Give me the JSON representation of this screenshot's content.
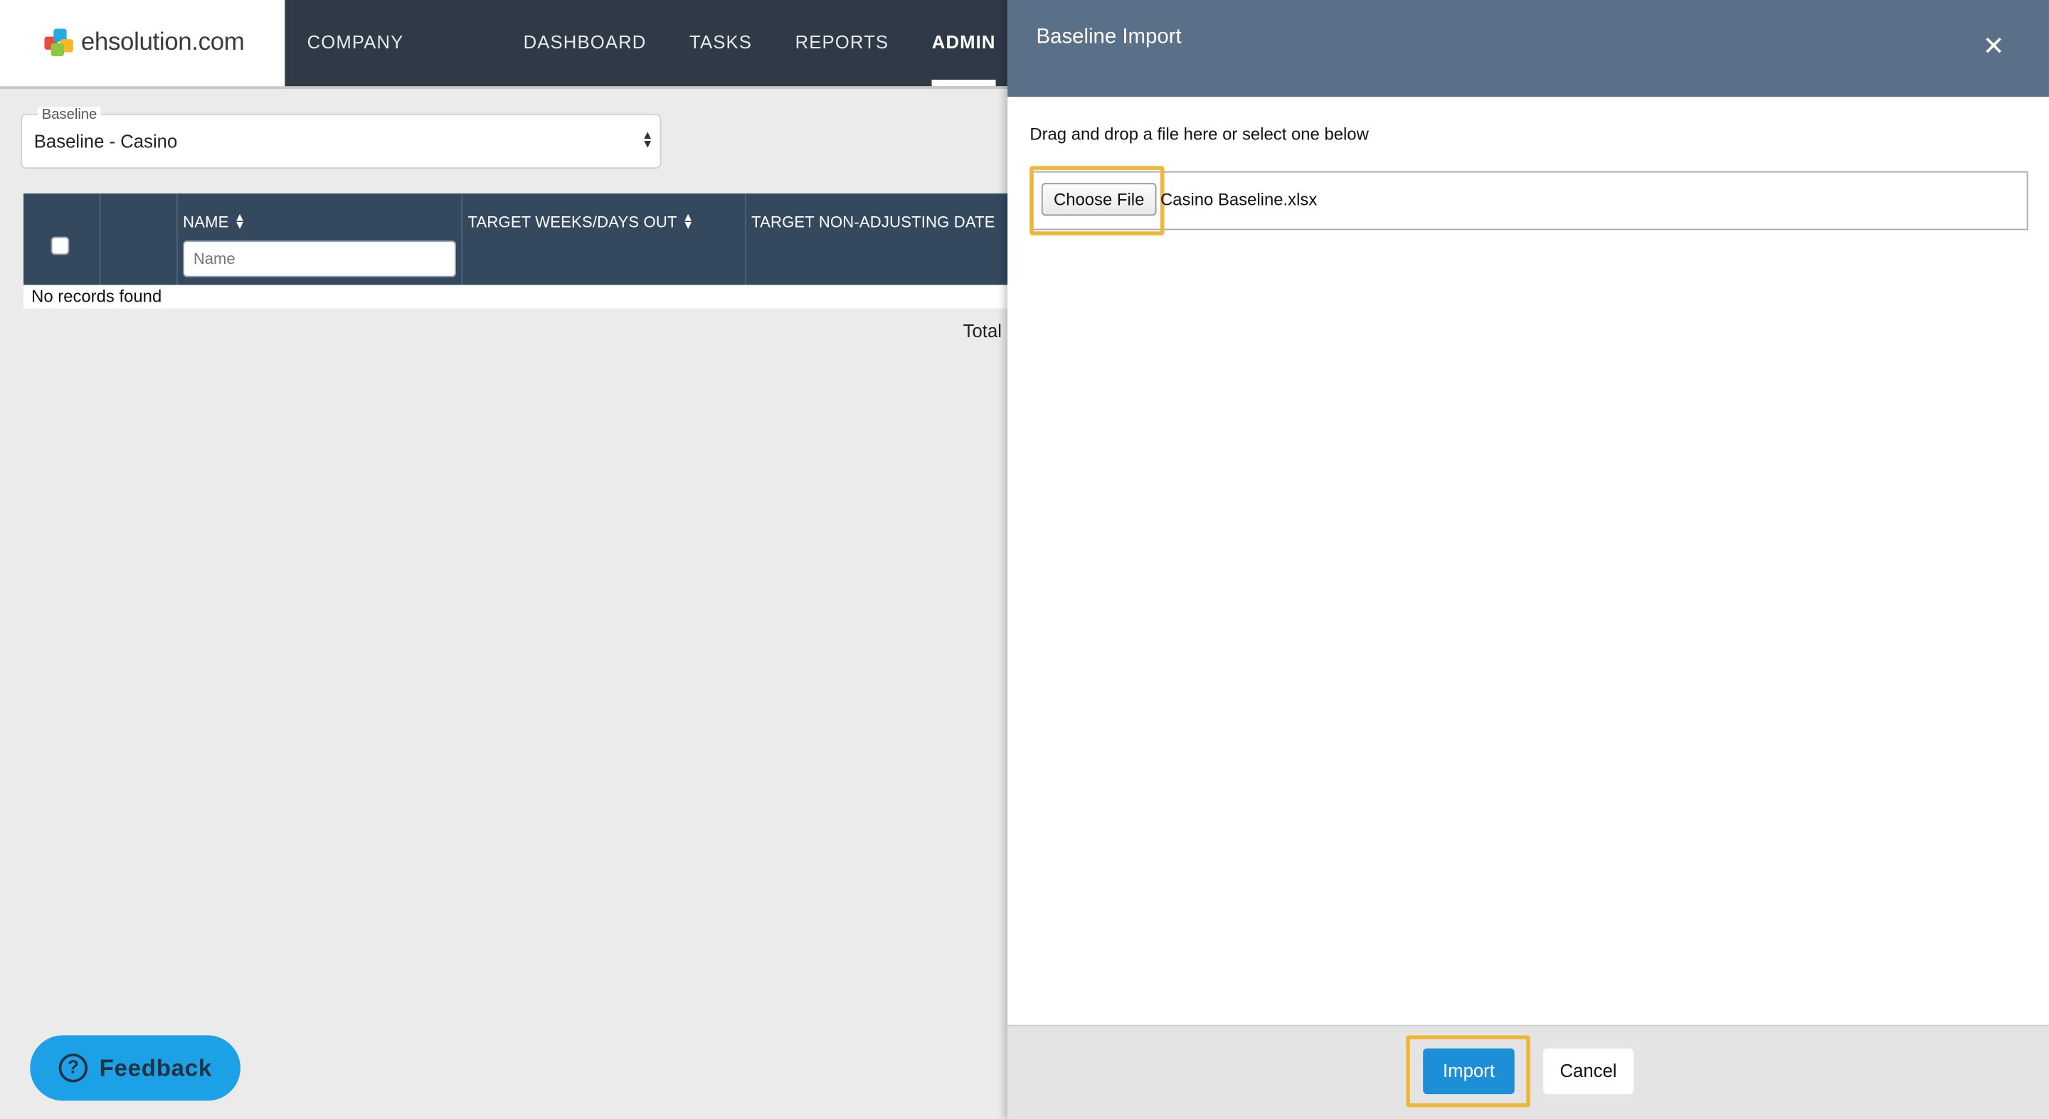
{
  "brand": {
    "logo_text": "ehsolution.com"
  },
  "nav": {
    "items": [
      {
        "label": "COMPANY OVERVIEW"
      },
      {
        "label": "DASHBOARD"
      },
      {
        "label": "TASKS"
      },
      {
        "label": "REPORTS"
      },
      {
        "label": "ADMIN",
        "active": true
      }
    ]
  },
  "baseline_select": {
    "label": "Baseline",
    "value": "Baseline - Casino"
  },
  "table": {
    "columns": [
      {
        "label": ""
      },
      {
        "label": ""
      },
      {
        "label": "NAME",
        "sortable": true
      },
      {
        "label": "TARGET WEEKS/DAYS OUT",
        "sortable": true
      },
      {
        "label": "TARGET NON-ADJUSTING DATE"
      }
    ],
    "name_filter_placeholder": "Name",
    "empty_text": "No records found",
    "total_label": "Total"
  },
  "feedback": {
    "label": "Feedback"
  },
  "modal": {
    "title": "Baseline Import",
    "instructions": "Drag and drop a file here or select one below",
    "choose_file_label": "Choose File",
    "file_name": "Casino Baseline.xlsx",
    "import_label": "Import",
    "cancel_label": "Cancel",
    "highlight_color": "#f0b636"
  },
  "colors": {
    "navbar": "#2f3a47",
    "table_header": "#34495e",
    "modal_header": "#5a6f88",
    "primary_button": "#1d8fd6",
    "feedback_button": "#1da1e6"
  }
}
